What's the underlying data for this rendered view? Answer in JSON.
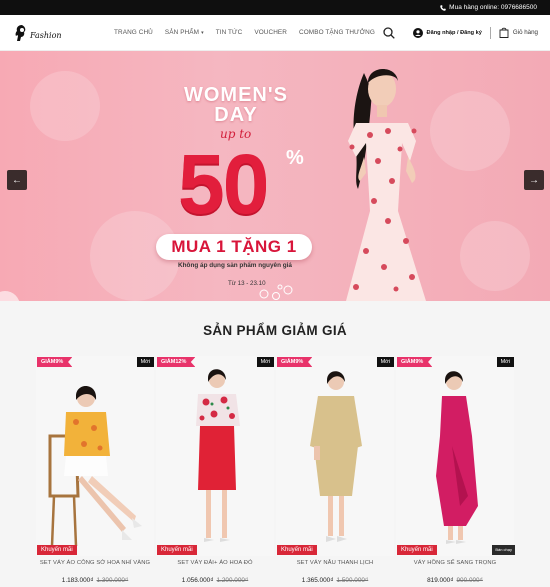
{
  "topbar": {
    "phone_icon": "phone-icon",
    "phone_text": "Mua hàng online: 0976686500"
  },
  "header": {
    "logo_text": "Fashion",
    "nav": [
      {
        "label": "TRANG CHỦ"
      },
      {
        "label": "SẢN PHẨM",
        "dropdown": true
      },
      {
        "label": "TIN TỨC"
      },
      {
        "label": "VOUCHER"
      },
      {
        "label": "COMBO TẶNG THƯỞNG"
      }
    ],
    "account_label": "Đăng nhập / Đăng ký",
    "cart_label": "Giỏ hàng"
  },
  "hero": {
    "line1": "WOMEN'S",
    "line2": "DAY",
    "upto": "up to",
    "discount": "50",
    "percent": "%",
    "offer": "MUA 1 TẶNG 1",
    "note": "Không áp dụng sản phẩm nguyên giá",
    "dates": "Từ 13 - 23.10",
    "prev_arrow": "←",
    "next_arrow": "→",
    "colors": {
      "bg": "#f5b0bb",
      "accent": "#e21e3c"
    }
  },
  "section": {
    "title": "SẢN PHẨM GIẢM GIÁ",
    "products": [
      {
        "discount": "GIẢM9%",
        "badge_new": "Mới",
        "promo": "Khuyến mãi",
        "name": "SET VÁY ÁO CÔNG SỞ HOA NHÍ VÀNG",
        "price": "1.183.000₫",
        "old_price": "1.300.000₫",
        "sold_out": ""
      },
      {
        "discount": "GIẢM12%",
        "badge_new": "Mới",
        "promo": "Khuyến mãi",
        "name": "SET VÁY ĐẢI+ ÁO HOA ĐỎ",
        "price": "1.056.000₫",
        "old_price": "1.200.000₫",
        "sold_out": ""
      },
      {
        "discount": "GIẢM9%",
        "badge_new": "Mới",
        "promo": "Khuyến mãi",
        "name": "SET VÁY NÂU THANH LỊCH",
        "price": "1.365.000₫",
        "old_price": "1.500.000₫",
        "sold_out": ""
      },
      {
        "discount": "GIẢM9%",
        "badge_new": "Mới",
        "promo": "Khuyến mãi",
        "name": "VÁY HỒNG SẾ SANG TRỌNG",
        "price": "819.000₫",
        "old_price": "900.000₫",
        "sold_out": "Bán chạy"
      }
    ]
  }
}
